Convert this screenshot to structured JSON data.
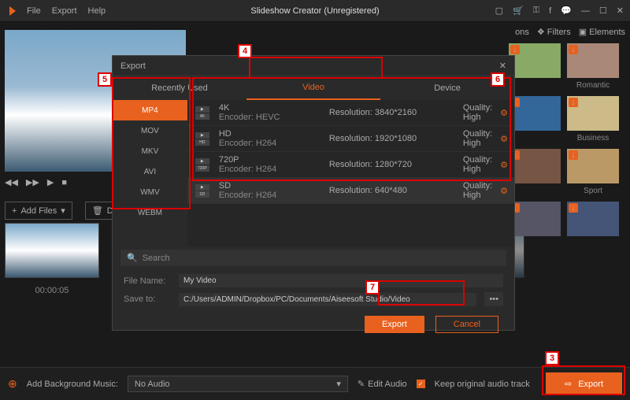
{
  "app_title": "Slideshow Creator (Unregistered)",
  "menus": [
    "File",
    "Export",
    "Help"
  ],
  "right_tabs": [
    "ons",
    "Filters",
    "Elements"
  ],
  "themes": [
    {
      "label": "Romantic"
    },
    {
      "label": ""
    },
    {
      "label": "Business"
    },
    {
      "label": ""
    },
    {
      "label": "Sport"
    },
    {
      "label": ""
    },
    {
      "label": ""
    }
  ],
  "addfiles_label": "Add Files",
  "delete_label": "Delete",
  "clip_time": "00:00:05",
  "bottom": {
    "bg_music": "Add Background Music:",
    "audio": "No Audio",
    "edit_audio": "Edit Audio",
    "keep_track": "Keep original audio track",
    "export": "Export"
  },
  "dialog": {
    "title": "Export",
    "tabs": [
      "Recently Used",
      "Video",
      "Device"
    ],
    "formats": [
      "MP4",
      "MOV",
      "MKV",
      "AVI",
      "WMV",
      "WEBM"
    ],
    "resolutions": [
      {
        "name": "4K",
        "badge": "4K",
        "encoder": "Encoder: HEVC",
        "res": "Resolution: 3840*2160",
        "q": "Quality: High"
      },
      {
        "name": "HD",
        "badge": "HD",
        "encoder": "Encoder: H264",
        "res": "Resolution: 1920*1080",
        "q": "Quality: High"
      },
      {
        "name": "720P",
        "badge": "720P",
        "encoder": "Encoder: H264",
        "res": "Resolution: 1280*720",
        "q": "Quality: High"
      },
      {
        "name": "SD",
        "badge": "SD",
        "encoder": "Encoder: H264",
        "res": "Resolution: 640*480",
        "q": "Quality: High"
      }
    ],
    "search": "Search",
    "filename_label": "File Name:",
    "filename": "My Video",
    "saveto_label": "Save to:",
    "saveto": "C:/Users/ADMIN/Dropbox/PC/Documents/Aiseesoft Studio/Video",
    "export_btn": "Export",
    "cancel_btn": "Cancel"
  },
  "callouts": {
    "c3": "3",
    "c4": "4",
    "c5": "5",
    "c6": "6",
    "c7": "7"
  }
}
